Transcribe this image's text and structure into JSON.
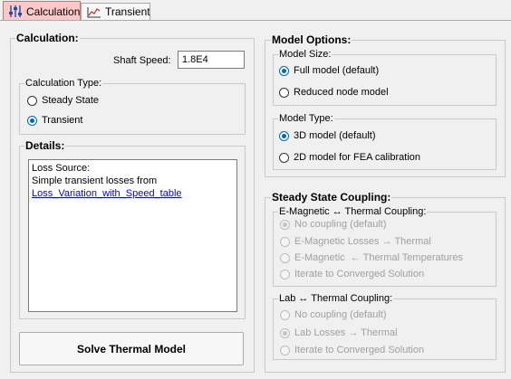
{
  "tabs": [
    {
      "label": "Calculation",
      "icon": "sliders-icon",
      "active": true
    },
    {
      "label": "Transient",
      "icon": "line-chart-icon",
      "active": false
    }
  ],
  "calculation": {
    "title": "Calculation:",
    "shaft_speed_label": "Shaft Speed:",
    "shaft_speed_value": "1.8E4",
    "type_title": "Calculation Type:",
    "type_options": [
      {
        "label": "Steady State",
        "checked": false
      },
      {
        "label": "Transient",
        "checked": true
      }
    ]
  },
  "details": {
    "title": "Details:",
    "line1": "Loss Source:",
    "line2": "Simple transient losses from",
    "link": "Loss_Variation_with_Speed_table"
  },
  "solve_button": "Solve Thermal Model",
  "model_options": {
    "title": "Model Options:",
    "size_title": "Model Size:",
    "size_options": [
      {
        "label": "Full model (default)",
        "checked": true
      },
      {
        "label": "Reduced node model",
        "checked": false
      }
    ],
    "type_title": "Model Type:",
    "type_options": [
      {
        "label": "3D model (default)",
        "checked": true
      },
      {
        "label": "2D model for FEA calibration",
        "checked": false
      }
    ]
  },
  "steady_state": {
    "title": "Steady State Coupling:",
    "emag_title": "E-Magnetic ↔ Thermal Coupling:",
    "emag_options": [
      {
        "label": "No coupling (default)",
        "checked": true
      },
      {
        "label": "E-Magnetic Losses → Thermal",
        "checked": false
      },
      {
        "label": "E-Magnetic  ← Thermal Temperatures",
        "checked": false
      },
      {
        "label": "Iterate to Converged Solution",
        "checked": false
      }
    ],
    "lab_title": "Lab ↔ Thermal Coupling:",
    "lab_options": [
      {
        "label": "No coupling (default)",
        "checked": false
      },
      {
        "label": "Lab Losses → Thermal",
        "checked": true
      },
      {
        "label": "Iterate to Converged Solution",
        "checked": false
      }
    ]
  },
  "colors": {
    "active_tab": "#ffc8c8",
    "radio_checked": "#0067c0",
    "link": "#0000ee"
  }
}
